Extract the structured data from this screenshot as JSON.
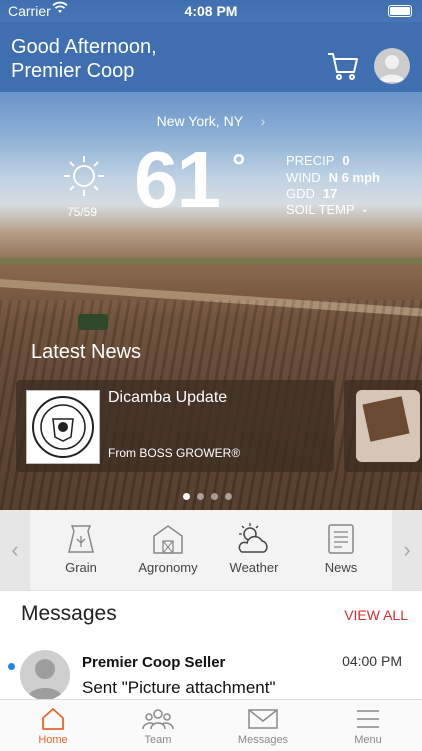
{
  "status_bar": {
    "carrier": "Carrier",
    "time": "4:08 PM"
  },
  "header": {
    "greeting": "Good Afternoon,",
    "name": "Premier Coop"
  },
  "weather": {
    "location": "New York, NY",
    "temperature": "61",
    "degree": "°",
    "hi_lo": "75/59",
    "precip_label": "PRECIP",
    "precip_value": "0",
    "wind_label": "WIND",
    "wind_value": "N 6 mph",
    "gdd_label": "GDD",
    "gdd_value": "17",
    "soil_label": "SOIL TEMP",
    "soil_value": "-"
  },
  "news": {
    "heading": "Latest News",
    "cards": [
      {
        "title": "Dicamba Update",
        "source": "From BOSS GROWER®"
      }
    ],
    "dots": 4,
    "active_dot": 0
  },
  "quick_links": [
    {
      "label": "Grain",
      "icon": "grain-bag-icon"
    },
    {
      "label": "Agronomy",
      "icon": "barn-icon"
    },
    {
      "label": "Weather",
      "icon": "partly-cloudy-icon"
    },
    {
      "label": "News",
      "icon": "newspaper-icon"
    }
  ],
  "messages": {
    "heading": "Messages",
    "view_all": "VIEW ALL",
    "items": [
      {
        "sender": "Premier Coop Seller",
        "text": "Sent \"Picture attachment\"",
        "time": "04:00 PM",
        "unread": true
      }
    ]
  },
  "tabbar": [
    {
      "label": "Home",
      "icon": "home-icon",
      "active": true
    },
    {
      "label": "Team",
      "icon": "team-icon",
      "active": false
    },
    {
      "label": "Messages",
      "icon": "envelope-icon",
      "active": false
    },
    {
      "label": "Menu",
      "icon": "hamburger-icon",
      "active": false
    }
  ],
  "colors": {
    "accent": "#e8662a",
    "view_all": "#d32f2f",
    "header_blue": "#3f6fb0",
    "unread_dot": "#1e88e5"
  }
}
